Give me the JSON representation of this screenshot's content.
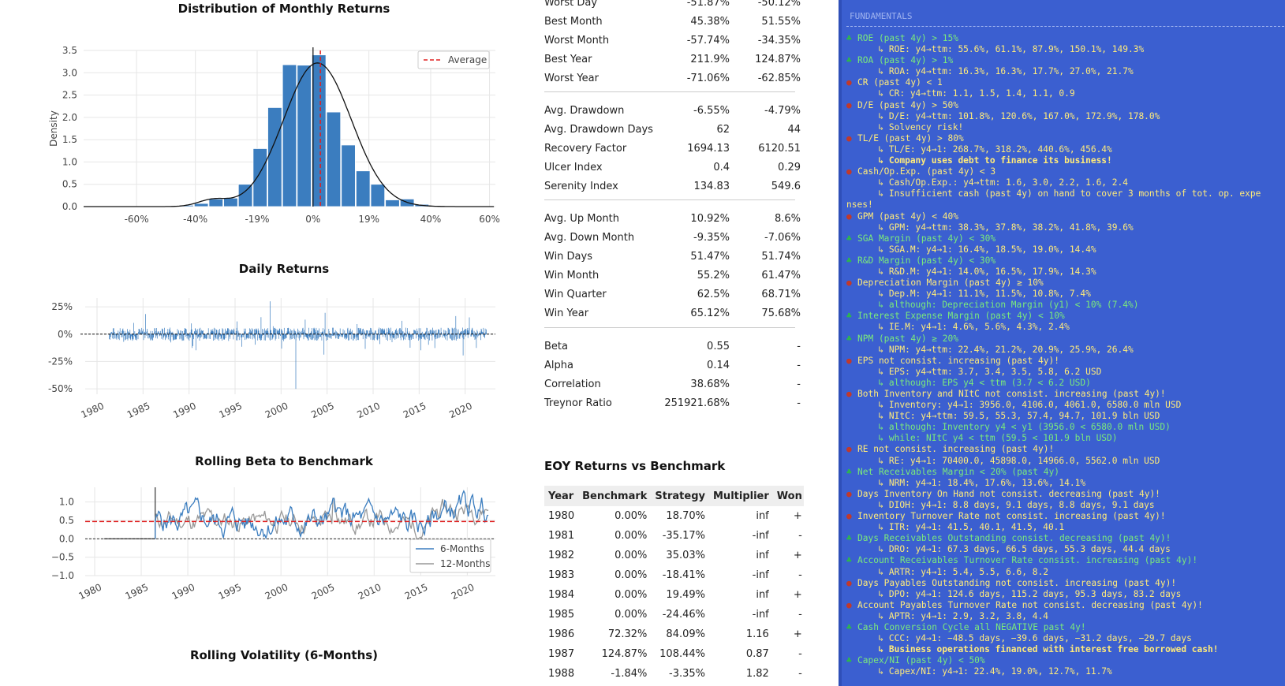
{
  "colors": {
    "accent": "#3b7dbf",
    "terminal_bg": "#3b5fd0",
    "pass": "#7bea7b",
    "fail": "#ffeb7a",
    "average_line": "#e02020"
  },
  "charts": {
    "distribution": {
      "title": "Distribution of Monthly Returns",
      "ylabel": "Density",
      "legend": "Average",
      "yticks": [
        "0.0",
        "0.5",
        "1.0",
        "1.5",
        "2.0",
        "2.5",
        "3.0",
        "3.5"
      ],
      "xticks": [
        "-60%",
        "-40%",
        "-19%",
        "0%",
        "19%",
        "40%",
        "60%"
      ]
    },
    "daily": {
      "title": "Daily Returns",
      "yticks": [
        "25%",
        "0%",
        "-25%",
        "-50%"
      ],
      "xticks": [
        "1980",
        "1985",
        "1990",
        "1995",
        "2000",
        "2005",
        "2010",
        "2015",
        "2020"
      ]
    },
    "beta": {
      "title": "Rolling Beta to Benchmark",
      "yticks": [
        "1.0",
        "0.5",
        "0.0",
        "−0.5",
        "−1.0"
      ],
      "xticks": [
        "1980",
        "1985",
        "1990",
        "1995",
        "2000",
        "2005",
        "2010",
        "2015",
        "2020"
      ],
      "legend": [
        "6-Months",
        "12-Months"
      ]
    },
    "volatility": {
      "title": "Rolling Volatility (6-Months)"
    }
  },
  "chart_data": [
    {
      "type": "bar",
      "title": "Distribution of Monthly Returns",
      "ylabel": "Density",
      "ylim": [
        0,
        3.5
      ],
      "x": [
        -0.43,
        -0.38,
        -0.33,
        -0.28,
        -0.23,
        -0.18,
        -0.13,
        -0.08,
        -0.03,
        0.02,
        0.07,
        0.12,
        0.17,
        0.22,
        0.27,
        0.32,
        0.37
      ],
      "values": [
        0.03,
        0.07,
        0.17,
        0.19,
        0.5,
        1.3,
        2.22,
        3.18,
        3.17,
        3.4,
        2.12,
        1.38,
        0.8,
        0.5,
        0.15,
        0.17,
        0.05
      ],
      "average": 0.025
    },
    {
      "type": "line",
      "title": "Daily Returns",
      "xlim": [
        1980,
        2022
      ],
      "ylim": [
        -0.5,
        0.3
      ]
    },
    {
      "type": "line",
      "title": "Rolling Beta to Benchmark",
      "xlim": [
        1980,
        2022
      ],
      "ylim": [
        -1.0,
        1.4
      ],
      "average": 0.47,
      "series": [
        {
          "name": "6-Months"
        },
        {
          "name": "12-Months"
        }
      ]
    }
  ],
  "metrics_top": [
    {
      "label": "Worst Day",
      "strategy": "-51.87%",
      "benchmark": "-50.12%"
    },
    {
      "label": "Best Month",
      "strategy": "45.38%",
      "benchmark": "51.55%"
    },
    {
      "label": "Worst Month",
      "strategy": "-57.74%",
      "benchmark": "-34.35%"
    },
    {
      "label": "Best Year",
      "strategy": "211.9%",
      "benchmark": "124.87%"
    },
    {
      "label": "Worst Year",
      "strategy": "-71.06%",
      "benchmark": "-62.85%"
    }
  ],
  "metrics_drawdown": [
    {
      "label": "Avg. Drawdown",
      "strategy": "-6.55%",
      "benchmark": "-4.79%"
    },
    {
      "label": "Avg. Drawdown Days",
      "strategy": "62",
      "benchmark": "44"
    },
    {
      "label": "Recovery Factor",
      "strategy": "1694.13",
      "benchmark": "6120.51"
    },
    {
      "label": "Ulcer Index",
      "strategy": "0.4",
      "benchmark": "0.29"
    },
    {
      "label": "Serenity Index",
      "strategy": "134.83",
      "benchmark": "549.6"
    }
  ],
  "metrics_win": [
    {
      "label": "Avg. Up Month",
      "strategy": "10.92%",
      "benchmark": "8.6%"
    },
    {
      "label": "Avg. Down Month",
      "strategy": "-9.35%",
      "benchmark": "-7.06%"
    },
    {
      "label": "Win Days",
      "strategy": "51.47%",
      "benchmark": "51.74%"
    },
    {
      "label": "Win Month",
      "strategy": "55.2%",
      "benchmark": "61.47%"
    },
    {
      "label": "Win Quarter",
      "strategy": "62.5%",
      "benchmark": "68.71%"
    },
    {
      "label": "Win Year",
      "strategy": "65.12%",
      "benchmark": "75.68%"
    }
  ],
  "metrics_risk": [
    {
      "label": "Beta",
      "strategy": "0.55",
      "benchmark": "-"
    },
    {
      "label": "Alpha",
      "strategy": "0.14",
      "benchmark": "-"
    },
    {
      "label": "Correlation",
      "strategy": "38.68%",
      "benchmark": "-"
    },
    {
      "label": "Treynor Ratio",
      "strategy": "251921.68%",
      "benchmark": "-"
    }
  ],
  "eoy": {
    "title": "EOY Returns vs Benchmark",
    "headers": [
      "Year",
      "Benchmark",
      "Strategy",
      "Multiplier",
      "Won"
    ],
    "rows": [
      [
        "1980",
        "0.00%",
        "18.70%",
        "inf",
        "+"
      ],
      [
        "1981",
        "0.00%",
        "-35.17%",
        "-inf",
        "-"
      ],
      [
        "1982",
        "0.00%",
        "35.03%",
        "inf",
        "+"
      ],
      [
        "1983",
        "0.00%",
        "-18.41%",
        "-inf",
        "-"
      ],
      [
        "1984",
        "0.00%",
        "19.49%",
        "inf",
        "+"
      ],
      [
        "1985",
        "0.00%",
        "-24.46%",
        "-inf",
        "-"
      ],
      [
        "1986",
        "72.32%",
        "84.09%",
        "1.16",
        "+"
      ],
      [
        "1987",
        "124.87%",
        "108.44%",
        "0.87",
        "-"
      ],
      [
        "1988",
        "-1.84%",
        "-3.35%",
        "1.82",
        "-"
      ]
    ]
  },
  "terminal": {
    "header": "FUNDAMENTALS",
    "lines": [
      {
        "kind": "ok",
        "text": "ROE (past 4y) > 15%"
      },
      {
        "kind": "sub",
        "text": "      ↳ ROE: y4→ttm: 55.6%, 61.1%, 87.9%, 150.1%, 149.3%"
      },
      {
        "kind": "ok",
        "text": "ROA (past 4y) > 1%"
      },
      {
        "kind": "sub",
        "text": "      ↳ ROA: y4→ttm: 16.3%, 16.3%, 17.7%, 27.0%, 21.7%"
      },
      {
        "kind": "bad",
        "text": "CR (past 4y) < 1"
      },
      {
        "kind": "sub",
        "text": "      ↳ CR: y4→ttm: 1.1, 1.5, 1.4, 1.1, 0.9"
      },
      {
        "kind": "bad",
        "text": "D/E (past 4y) > 50%"
      },
      {
        "kind": "sub",
        "text": "      ↳ D/E: y4→ttm: 101.8%, 120.6%, 167.0%, 172.9%, 178.0%"
      },
      {
        "kind": "sub",
        "text": "      ↳ Solvency risk!"
      },
      {
        "kind": "bad",
        "text": "TL/E (past 4y) > 80%"
      },
      {
        "kind": "sub",
        "text": "      ↳ TL/E: y4→1: 268.7%, 318.2%, 440.6%, 456.4%"
      },
      {
        "kind": "warn",
        "text": "      ↳ Company uses debt to finance its business!"
      },
      {
        "kind": "bad",
        "text": "Cash/Op.Exp. (past 4y) < 3"
      },
      {
        "kind": "sub",
        "text": "      ↳ Cash/Op.Exp.: y4→ttm: 1.6, 3.0, 2.2, 1.6, 2.4"
      },
      {
        "kind": "sub",
        "text": "      ↳ Insufficient cash (past 4y) on hand to cover 3 months of tot. op. expe"
      },
      {
        "kind": "wrap",
        "text": "nses!"
      },
      {
        "kind": "bad",
        "text": "GPM (past 4y) < 40%"
      },
      {
        "kind": "sub",
        "text": "      ↳ GPM: y4→ttm: 38.3%, 37.8%, 38.2%, 41.8%, 39.6%"
      },
      {
        "kind": "ok",
        "text": "SGA Margin (past 4y) < 30%"
      },
      {
        "kind": "sub",
        "text": "      ↳ SGA.M: y4→1: 16.4%, 18.5%, 19.0%, 14.4%"
      },
      {
        "kind": "ok",
        "text": "R&D Margin (past 4y) < 30%"
      },
      {
        "kind": "sub",
        "text": "      ↳ R&D.M: y4→1: 14.0%, 16.5%, 17.9%, 14.3%"
      },
      {
        "kind": "bad",
        "text": "Depreciation Margin (past 4y) ≥ 10%"
      },
      {
        "kind": "sub",
        "text": "      ↳ Dep.M: y4→1: 11.1%, 11.5%, 10.8%, 7.4%"
      },
      {
        "kind": "subok",
        "text": "      ↳ although: Depreciation Margin (y1) < 10% (7.4%)"
      },
      {
        "kind": "ok",
        "text": "Interest Expense Margin (past 4y) < 10%"
      },
      {
        "kind": "sub",
        "text": "      ↳ IE.M: y4→1: 4.6%, 5.6%, 4.3%, 2.4%"
      },
      {
        "kind": "ok",
        "text": "NPM (past 4y) ≥ 20%"
      },
      {
        "kind": "sub",
        "text": "      ↳ NPM: y4→ttm: 22.4%, 21.2%, 20.9%, 25.9%, 26.4%"
      },
      {
        "kind": "bad",
        "text": "EPS not consist. increasing (past 4y)!"
      },
      {
        "kind": "sub",
        "text": "      ↳ EPS: y4→ttm: 3.7, 3.4, 3.5, 5.8, 6.2 USD"
      },
      {
        "kind": "subok",
        "text": "      ↳ although: EPS y4 < ttm (3.7 < 6.2 USD)"
      },
      {
        "kind": "bad",
        "text": "Both Inventory and NItC not consist. increasing (past 4y)!"
      },
      {
        "kind": "sub",
        "text": "      ↳ Inventory: y4→1: 3956.0, 4106.0, 4061.0, 6580.0 mln USD"
      },
      {
        "kind": "sub",
        "text": "      ↳ NItC: y4→ttm: 59.5, 55.3, 57.4, 94.7, 101.9 bln USD"
      },
      {
        "kind": "subok",
        "text": "      ↳ although: Inventory y4 < y1 (3956.0 < 6580.0 mln USD)"
      },
      {
        "kind": "subok",
        "text": "      ↳ while: NItC y4 < ttm (59.5 < 101.9 bln USD)"
      },
      {
        "kind": "bad",
        "text": "RE not consist. increasing (past 4y)!"
      },
      {
        "kind": "sub",
        "text": "      ↳ RE: y4→1: 70400.0, 45898.0, 14966.0, 5562.0 mln USD"
      },
      {
        "kind": "ok",
        "text": "Net Receivables Margin < 20% (past 4y)"
      },
      {
        "kind": "sub",
        "text": "      ↳ NRM: y4→1: 18.4%, 17.6%, 13.6%, 14.1%"
      },
      {
        "kind": "bad",
        "text": "Days Inventory On Hand not consist. decreasing (past 4y)!"
      },
      {
        "kind": "sub",
        "text": "      ↳ DIOH: y4→1: 8.8 days, 9.1 days, 8.8 days, 9.1 days"
      },
      {
        "kind": "bad",
        "text": "Inventory Turnover Rate not consist. increasing (past 4y)!"
      },
      {
        "kind": "sub",
        "text": "      ↳ ITR: y4→1: 41.5, 40.1, 41.5, 40.1"
      },
      {
        "kind": "ok",
        "text": "Days Receivables Outstanding consist. decreasing (past 4y)!"
      },
      {
        "kind": "sub",
        "text": "      ↳ DRO: y4→1: 67.3 days, 66.5 days, 55.3 days, 44.4 days"
      },
      {
        "kind": "ok",
        "text": "Account Receivables Turnover Rate consist. increasing (past 4y)!"
      },
      {
        "kind": "sub",
        "text": "      ↳ ARTR: y4→1: 5.4, 5.5, 6.6, 8.2"
      },
      {
        "kind": "bad",
        "text": "Days Payables Outstanding not consist. increasing (past 4y)!"
      },
      {
        "kind": "sub",
        "text": "      ↳ DPO: y4→1: 124.6 days, 115.2 days, 95.3 days, 83.2 days"
      },
      {
        "kind": "bad",
        "text": "Account Payables Turnover Rate not consist. decreasing (past 4y)!"
      },
      {
        "kind": "sub",
        "text": "      ↳ APTR: y4→1: 2.9, 3.2, 3.8, 4.4"
      },
      {
        "kind": "ok",
        "text": "Cash Conversion Cycle all NEGATIVE past 4y!"
      },
      {
        "kind": "sub",
        "text": "      ↳ CCC: y4→1: −48.5 days, −39.6 days, −31.2 days, −29.7 days"
      },
      {
        "kind": "warn",
        "text": "      ↳ Business operations financed with interest free borrowed cash!"
      },
      {
        "kind": "ok",
        "text": "Capex/NI (past 4y) < 50%"
      },
      {
        "kind": "sub",
        "text": "      ↳ Capex/NI: y4→1: 22.4%, 19.0%, 12.7%, 11.7%"
      }
    ]
  }
}
